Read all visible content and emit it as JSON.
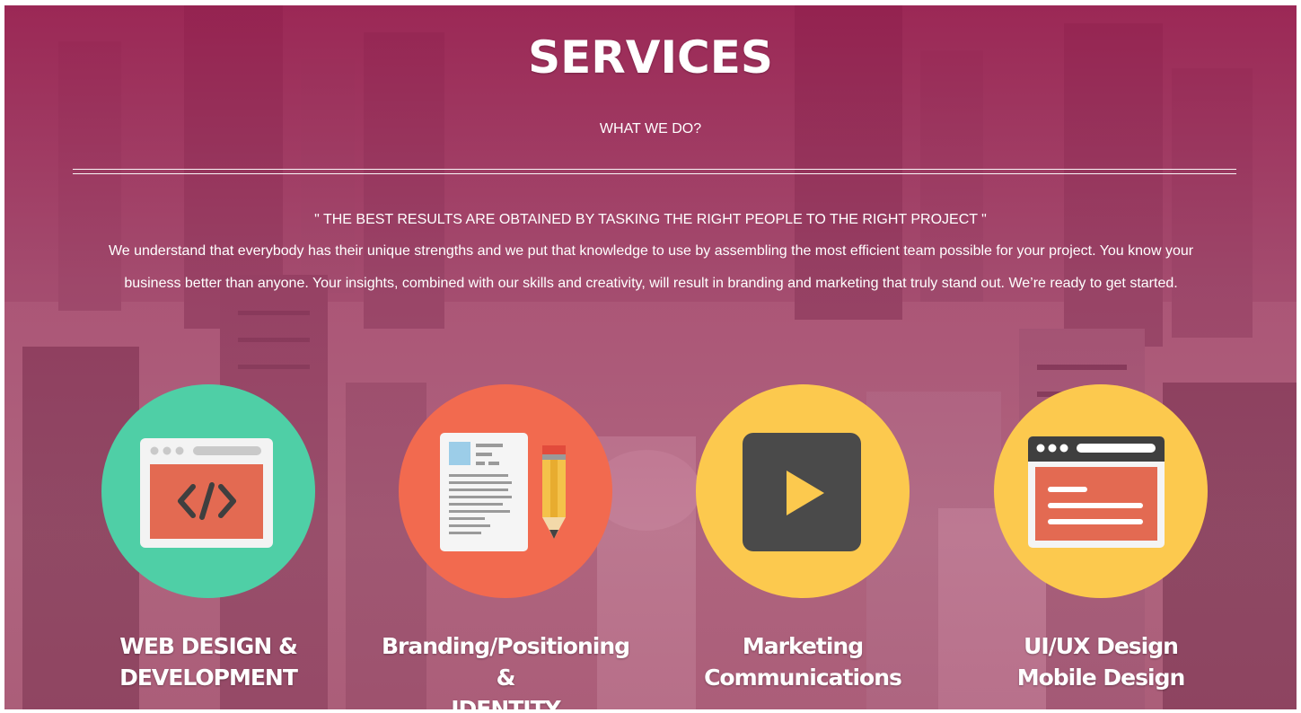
{
  "header": {
    "title": "SERVICES",
    "subtitle": "WHAT WE DO?"
  },
  "intro": {
    "quote": "\" THE BEST RESULTS ARE OBTAINED BY TASKING THE RIGHT PEOPLE TO THE RIGHT PROJECT \"",
    "paragraph": "We understand that everybody has their unique strengths and we put that knowledge to use by assembling the most efficient team possible for your project. You know your business better than anyone. Your insights, combined with our skills and creativity, will result in branding and marketing that truly stand out. We’re ready to get started."
  },
  "services": [
    {
      "line1": "WEB DESIGN &",
      "line2": "DEVELOPMENT",
      "icon": "code-window-icon",
      "color": "#4fcfa6"
    },
    {
      "line1": "Branding/Positioning &",
      "line2": "IDENTITY",
      "icon": "document-pencil-icon",
      "color": "#f26a4f"
    },
    {
      "line1": "Marketing",
      "line2": "Communications",
      "icon": "play-icon",
      "color": "#fcc94e"
    },
    {
      "line1": "UI/UX Design",
      "line2": "Mobile Design",
      "icon": "browser-window-icon",
      "color": "#fcc94e"
    }
  ],
  "colors": {
    "overlay": "#a8185a",
    "teal": "#4fcfa6",
    "coral": "#f26a4f",
    "yellow": "#fcc94e",
    "dark": "#4a4a4a"
  }
}
